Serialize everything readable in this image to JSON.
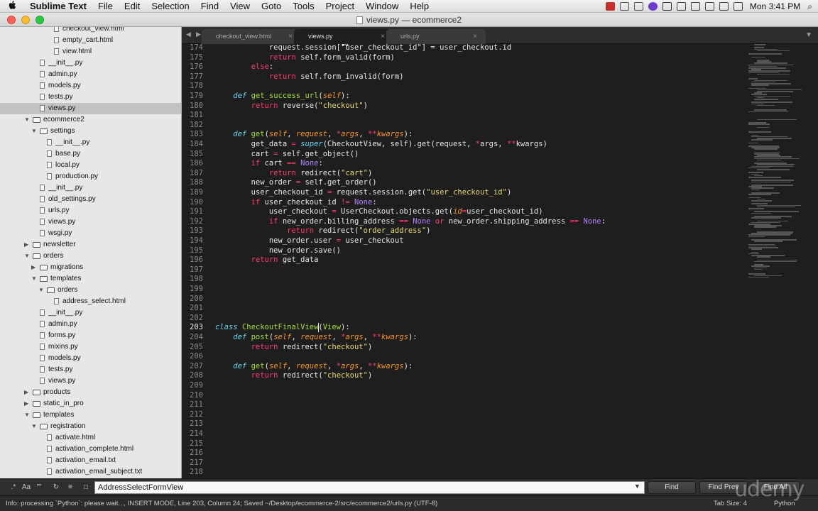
{
  "menubar": {
    "apple_icon": "apple-logo",
    "items": [
      "Sublime Text",
      "File",
      "Edit",
      "Selection",
      "Find",
      "View",
      "Goto",
      "Tools",
      "Project",
      "Window",
      "Help"
    ],
    "clock": "Mon 3:41 PM",
    "tray_icons": [
      "recording-icon",
      "notification-icon",
      "upload-icon",
      "creative-cloud-icon",
      "browser-icon",
      "time-machine-icon",
      "bluetooth-icon",
      "battery-icon",
      "wifi-icon",
      "volume-icon",
      "search-icon",
      "list-icon"
    ]
  },
  "window": {
    "title": "views.py — ecommerce2",
    "traffic_colors": [
      "#ff5f57",
      "#ffbd2e",
      "#28c940"
    ]
  },
  "sidebar": {
    "rows": [
      {
        "label": "checkout_view.html",
        "depth": 5,
        "type": "file"
      },
      {
        "label": "empty_cart.html",
        "depth": 5,
        "type": "file"
      },
      {
        "label": "view.html",
        "depth": 5,
        "type": "file"
      },
      {
        "label": "__init__.py",
        "depth": 3,
        "type": "file"
      },
      {
        "label": "admin.py",
        "depth": 3,
        "type": "file"
      },
      {
        "label": "models.py",
        "depth": 3,
        "type": "file"
      },
      {
        "label": "tests.py",
        "depth": 3,
        "type": "file"
      },
      {
        "label": "views.py",
        "depth": 3,
        "type": "file",
        "selected": true
      },
      {
        "label": "ecommerce2",
        "depth": 1,
        "type": "folder",
        "open": true
      },
      {
        "label": "settings",
        "depth": 2,
        "type": "folder",
        "open": true
      },
      {
        "label": "__init__.py",
        "depth": 4,
        "type": "file"
      },
      {
        "label": "base.py",
        "depth": 4,
        "type": "file"
      },
      {
        "label": "local.py",
        "depth": 4,
        "type": "file"
      },
      {
        "label": "production.py",
        "depth": 4,
        "type": "file"
      },
      {
        "label": "__init__.py",
        "depth": 3,
        "type": "file"
      },
      {
        "label": "old_settings.py",
        "depth": 3,
        "type": "file"
      },
      {
        "label": "urls.py",
        "depth": 3,
        "type": "file"
      },
      {
        "label": "views.py",
        "depth": 3,
        "type": "file"
      },
      {
        "label": "wsgi.py",
        "depth": 3,
        "type": "file"
      },
      {
        "label": "newsletter",
        "depth": 1,
        "type": "folder",
        "open": false
      },
      {
        "label": "orders",
        "depth": 1,
        "type": "folder",
        "open": true
      },
      {
        "label": "migrations",
        "depth": 2,
        "type": "folder",
        "open": false
      },
      {
        "label": "templates",
        "depth": 2,
        "type": "folder",
        "open": true
      },
      {
        "label": "orders",
        "depth": 3,
        "type": "folder",
        "open": true
      },
      {
        "label": "address_select.html",
        "depth": 5,
        "type": "file"
      },
      {
        "label": "__init__.py",
        "depth": 3,
        "type": "file"
      },
      {
        "label": "admin.py",
        "depth": 3,
        "type": "file"
      },
      {
        "label": "forms.py",
        "depth": 3,
        "type": "file"
      },
      {
        "label": "mixins.py",
        "depth": 3,
        "type": "file"
      },
      {
        "label": "models.py",
        "depth": 3,
        "type": "file"
      },
      {
        "label": "tests.py",
        "depth": 3,
        "type": "file"
      },
      {
        "label": "views.py",
        "depth": 3,
        "type": "file"
      },
      {
        "label": "products",
        "depth": 1,
        "type": "folder",
        "open": false
      },
      {
        "label": "static_in_pro",
        "depth": 1,
        "type": "folder",
        "open": false
      },
      {
        "label": "templates",
        "depth": 1,
        "type": "folder",
        "open": true
      },
      {
        "label": "registration",
        "depth": 2,
        "type": "folder",
        "open": true
      },
      {
        "label": "activate.html",
        "depth": 4,
        "type": "file"
      },
      {
        "label": "activation_complete.html",
        "depth": 4,
        "type": "file"
      },
      {
        "label": "activation_email.txt",
        "depth": 4,
        "type": "file"
      },
      {
        "label": "activation_email_subject.txt",
        "depth": 4,
        "type": "file"
      }
    ]
  },
  "tabs": [
    {
      "label": "checkout_view.html",
      "active": false
    },
    {
      "label": "views.py",
      "active": true
    },
    {
      "label": "urls.py",
      "active": false
    }
  ],
  "editor": {
    "current_line": 203,
    "caret_line_index": 29,
    "caret_column": 24,
    "lines": [
      {
        "n": 174,
        "t": [
          [
            "            request.session[\"user_checkout_id\"] = user_checkout.id",
            ""
          ]
        ]
      },
      {
        "n": 175,
        "t": [
          [
            "            ",
            ""
          ],
          [
            "return",
            "kw"
          ],
          [
            " self.form_valid(form)",
            ""
          ]
        ]
      },
      {
        "n": 176,
        "t": [
          [
            "        ",
            ""
          ],
          [
            "else",
            "kw"
          ],
          [
            ":",
            ""
          ]
        ]
      },
      {
        "n": 177,
        "t": [
          [
            "            ",
            ""
          ],
          [
            "return",
            "kw"
          ],
          [
            " self.form_invalid(form)",
            ""
          ]
        ]
      },
      {
        "n": 178,
        "t": []
      },
      {
        "n": 179,
        "t": [
          [
            "    ",
            ""
          ],
          [
            "def",
            "def"
          ],
          [
            " ",
            ""
          ],
          [
            "get_success_url",
            "fn"
          ],
          [
            "(",
            ""
          ],
          [
            "self",
            "param"
          ],
          [
            "):",
            ""
          ]
        ]
      },
      {
        "n": 180,
        "t": [
          [
            "        ",
            ""
          ],
          [
            "return",
            "kw"
          ],
          [
            " reverse(",
            ""
          ],
          [
            "\"checkout\"",
            "str"
          ],
          [
            ")",
            ""
          ]
        ]
      },
      {
        "n": 181,
        "t": []
      },
      {
        "n": 182,
        "t": []
      },
      {
        "n": 183,
        "t": [
          [
            "    ",
            ""
          ],
          [
            "def",
            "def"
          ],
          [
            " ",
            ""
          ],
          [
            "get",
            "fn"
          ],
          [
            "(",
            ""
          ],
          [
            "self",
            "param"
          ],
          [
            ", ",
            ""
          ],
          [
            "request",
            "param"
          ],
          [
            ", ",
            ""
          ],
          [
            "*",
            "op"
          ],
          [
            "args",
            "param"
          ],
          [
            ", ",
            ""
          ],
          [
            "**",
            "op"
          ],
          [
            "kwargs",
            "param"
          ],
          [
            "):",
            ""
          ]
        ]
      },
      {
        "n": 184,
        "t": [
          [
            "        get_data ",
            ""
          ],
          [
            "=",
            "op"
          ],
          [
            " ",
            ""
          ],
          [
            "super",
            "def"
          ],
          [
            "(CheckoutView, self).get(request, ",
            ""
          ],
          [
            "*",
            "op"
          ],
          [
            "args, ",
            ""
          ],
          [
            "**",
            "op"
          ],
          [
            "kwargs)",
            ""
          ]
        ]
      },
      {
        "n": 185,
        "t": [
          [
            "        cart ",
            ""
          ],
          [
            "=",
            "op"
          ],
          [
            " self.get_object()",
            ""
          ]
        ]
      },
      {
        "n": 186,
        "t": [
          [
            "        ",
            ""
          ],
          [
            "if",
            "kw"
          ],
          [
            " cart ",
            ""
          ],
          [
            "==",
            "op"
          ],
          [
            " ",
            ""
          ],
          [
            "None",
            "const"
          ],
          [
            ":",
            ""
          ]
        ]
      },
      {
        "n": 187,
        "t": [
          [
            "            ",
            ""
          ],
          [
            "return",
            "kw"
          ],
          [
            " redirect(",
            ""
          ],
          [
            "\"cart\"",
            "str"
          ],
          [
            ")",
            ""
          ]
        ]
      },
      {
        "n": 188,
        "t": [
          [
            "        new_order ",
            ""
          ],
          [
            "=",
            "op"
          ],
          [
            " self.get_order()",
            ""
          ]
        ]
      },
      {
        "n": 189,
        "t": [
          [
            "        user_checkout_id ",
            ""
          ],
          [
            "=",
            "op"
          ],
          [
            " request.session.get(",
            ""
          ],
          [
            "\"user_checkout_id\"",
            "str"
          ],
          [
            ")",
            ""
          ]
        ]
      },
      {
        "n": 190,
        "t": [
          [
            "        ",
            ""
          ],
          [
            "if",
            "kw"
          ],
          [
            " user_checkout_id ",
            ""
          ],
          [
            "!=",
            "op"
          ],
          [
            " ",
            ""
          ],
          [
            "None",
            "const"
          ],
          [
            ":",
            ""
          ]
        ]
      },
      {
        "n": 191,
        "t": [
          [
            "            user_checkout ",
            ""
          ],
          [
            "=",
            "op"
          ],
          [
            " UserCheckout.objects.get(",
            ""
          ],
          [
            "id",
            "param"
          ],
          [
            "=",
            "op"
          ],
          [
            "user_checkout_id)",
            ""
          ]
        ]
      },
      {
        "n": 192,
        "t": [
          [
            "            ",
            ""
          ],
          [
            "if",
            "kw"
          ],
          [
            " new_order.billing_address ",
            ""
          ],
          [
            "==",
            "op"
          ],
          [
            " ",
            ""
          ],
          [
            "None",
            "const"
          ],
          [
            " ",
            ""
          ],
          [
            "or",
            "kw"
          ],
          [
            " new_order.shipping_address ",
            ""
          ],
          [
            "==",
            "op"
          ],
          [
            " ",
            ""
          ],
          [
            "None",
            "const"
          ],
          [
            ":",
            ""
          ]
        ]
      },
      {
        "n": 193,
        "t": [
          [
            "                ",
            ""
          ],
          [
            "return",
            "kw"
          ],
          [
            " redirect(",
            ""
          ],
          [
            "\"order_address\"",
            "str"
          ],
          [
            ")",
            ""
          ]
        ]
      },
      {
        "n": 194,
        "t": [
          [
            "            new_order.user ",
            ""
          ],
          [
            "=",
            "op"
          ],
          [
            " user_checkout",
            ""
          ]
        ]
      },
      {
        "n": 195,
        "t": [
          [
            "            new_order.save()",
            ""
          ]
        ]
      },
      {
        "n": 196,
        "t": [
          [
            "        ",
            ""
          ],
          [
            "return",
            "kw"
          ],
          [
            " get_data",
            ""
          ]
        ]
      },
      {
        "n": 197,
        "t": []
      },
      {
        "n": 198,
        "t": []
      },
      {
        "n": 199,
        "t": []
      },
      {
        "n": 200,
        "t": []
      },
      {
        "n": 201,
        "t": []
      },
      {
        "n": 202,
        "t": []
      },
      {
        "n": 203,
        "t": [
          [
            "class",
            "def"
          ],
          [
            " ",
            ""
          ],
          [
            "CheckoutFinalView",
            "fn"
          ],
          [
            "(",
            ""
          ],
          [
            "View",
            "fn"
          ],
          [
            "):",
            ""
          ]
        ]
      },
      {
        "n": 204,
        "t": [
          [
            "    ",
            ""
          ],
          [
            "def",
            "def"
          ],
          [
            " ",
            ""
          ],
          [
            "post",
            "fn"
          ],
          [
            "(",
            ""
          ],
          [
            "self",
            "param"
          ],
          [
            ", ",
            ""
          ],
          [
            "request",
            "param"
          ],
          [
            ", ",
            ""
          ],
          [
            "*",
            "op"
          ],
          [
            "args",
            "param"
          ],
          [
            ", ",
            ""
          ],
          [
            "**",
            "op"
          ],
          [
            "kwargs",
            "param"
          ],
          [
            "):",
            ""
          ]
        ]
      },
      {
        "n": 205,
        "t": [
          [
            "        ",
            ""
          ],
          [
            "return",
            "kw"
          ],
          [
            " redirect(",
            ""
          ],
          [
            "\"checkout\"",
            "str"
          ],
          [
            ")",
            ""
          ]
        ]
      },
      {
        "n": 206,
        "t": []
      },
      {
        "n": 207,
        "t": [
          [
            "    ",
            ""
          ],
          [
            "def",
            "def"
          ],
          [
            " ",
            ""
          ],
          [
            "get",
            "fn"
          ],
          [
            "(",
            ""
          ],
          [
            "self",
            "param"
          ],
          [
            ", ",
            ""
          ],
          [
            "request",
            "param"
          ],
          [
            ", ",
            ""
          ],
          [
            "*",
            "op"
          ],
          [
            "args",
            "param"
          ],
          [
            ", ",
            ""
          ],
          [
            "**",
            "op"
          ],
          [
            "kwargs",
            "param"
          ],
          [
            "):",
            ""
          ]
        ]
      },
      {
        "n": 208,
        "t": [
          [
            "        ",
            ""
          ],
          [
            "return",
            "kw"
          ],
          [
            " redirect(",
            ""
          ],
          [
            "\"checkout\"",
            "str"
          ],
          [
            ")",
            ""
          ]
        ]
      },
      {
        "n": 209,
        "t": []
      },
      {
        "n": 210,
        "t": []
      },
      {
        "n": 211,
        "t": []
      },
      {
        "n": 212,
        "t": []
      },
      {
        "n": 213,
        "t": []
      },
      {
        "n": 214,
        "t": []
      },
      {
        "n": 215,
        "t": []
      },
      {
        "n": 216,
        "t": []
      },
      {
        "n": 217,
        "t": []
      },
      {
        "n": 218,
        "t": []
      }
    ]
  },
  "find_panel": {
    "toggles": [
      "regex-toggle",
      "case-toggle",
      "whole-word-toggle",
      "wrap-toggle",
      "in-selection-toggle",
      "highlight-toggle"
    ],
    "toggle_glyphs": [
      ".*",
      "Aa",
      "\"\"",
      "↻",
      "≡",
      "□"
    ],
    "query": "AddressSelectFormView",
    "find_label": "Find",
    "find_prev_label": "Find Prev",
    "find_all_label": "Find All"
  },
  "status": {
    "text": "Info: processing `Python`: please wait..., INSERT MODE, Line 203, Column 24; Saved ~/Desktop/ecommerce-2/src/ecommerce2/urls.py (UTF-8)",
    "tab_size": "Tab Size: 4",
    "syntax": "Python"
  },
  "watermark": "udemy",
  "colors": {
    "keyword": "#ff3b6b",
    "def": "#66d9ef",
    "function": "#a6e22e",
    "string": "#e6db74",
    "param": "#fd971f",
    "constant": "#ae81ff",
    "background": "#1e1e1e"
  }
}
